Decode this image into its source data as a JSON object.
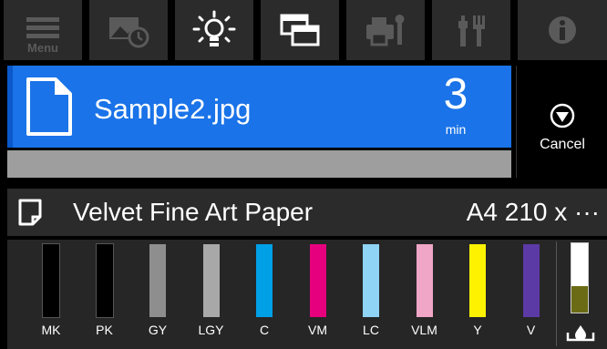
{
  "toolbar": {
    "menu_label": "Menu",
    "buttons": [
      {
        "name": "menu-icon"
      },
      {
        "name": "photo-schedule-icon"
      },
      {
        "name": "light-bulb-icon"
      },
      {
        "name": "windows-icon"
      },
      {
        "name": "printer-wrench-icon"
      },
      {
        "name": "maintenance-tools-icon"
      },
      {
        "name": "info-icon"
      }
    ]
  },
  "job": {
    "file_name": "Sample2.jpg",
    "time_value": "3",
    "time_unit": "min",
    "progress": 0.0,
    "cancel_label": "Cancel"
  },
  "paper": {
    "name": "Velvet Fine Art Paper",
    "size": "A4 210 x ···"
  },
  "inks": [
    {
      "label": "MK",
      "color": "#000000",
      "level": 1.0
    },
    {
      "label": "PK",
      "color": "#000000",
      "level": 1.0
    },
    {
      "label": "GY",
      "color": "#8e8e8e",
      "level": 1.0
    },
    {
      "label": "LGY",
      "color": "#a8a8a8",
      "level": 1.0
    },
    {
      "label": "C",
      "color": "#00a0e6",
      "level": 1.0
    },
    {
      "label": "VM",
      "color": "#e6007e",
      "level": 1.0
    },
    {
      "label": "LC",
      "color": "#8fd3f5",
      "level": 1.0
    },
    {
      "label": "VLM",
      "color": "#f0a6c6",
      "level": 1.0
    },
    {
      "label": "Y",
      "color": "#fff200",
      "level": 1.0
    },
    {
      "label": "V",
      "color": "#5b3aa6",
      "level": 1.0
    }
  ],
  "maintenance_box": {
    "level": 0.38,
    "fill_color": "#6b6b15"
  }
}
